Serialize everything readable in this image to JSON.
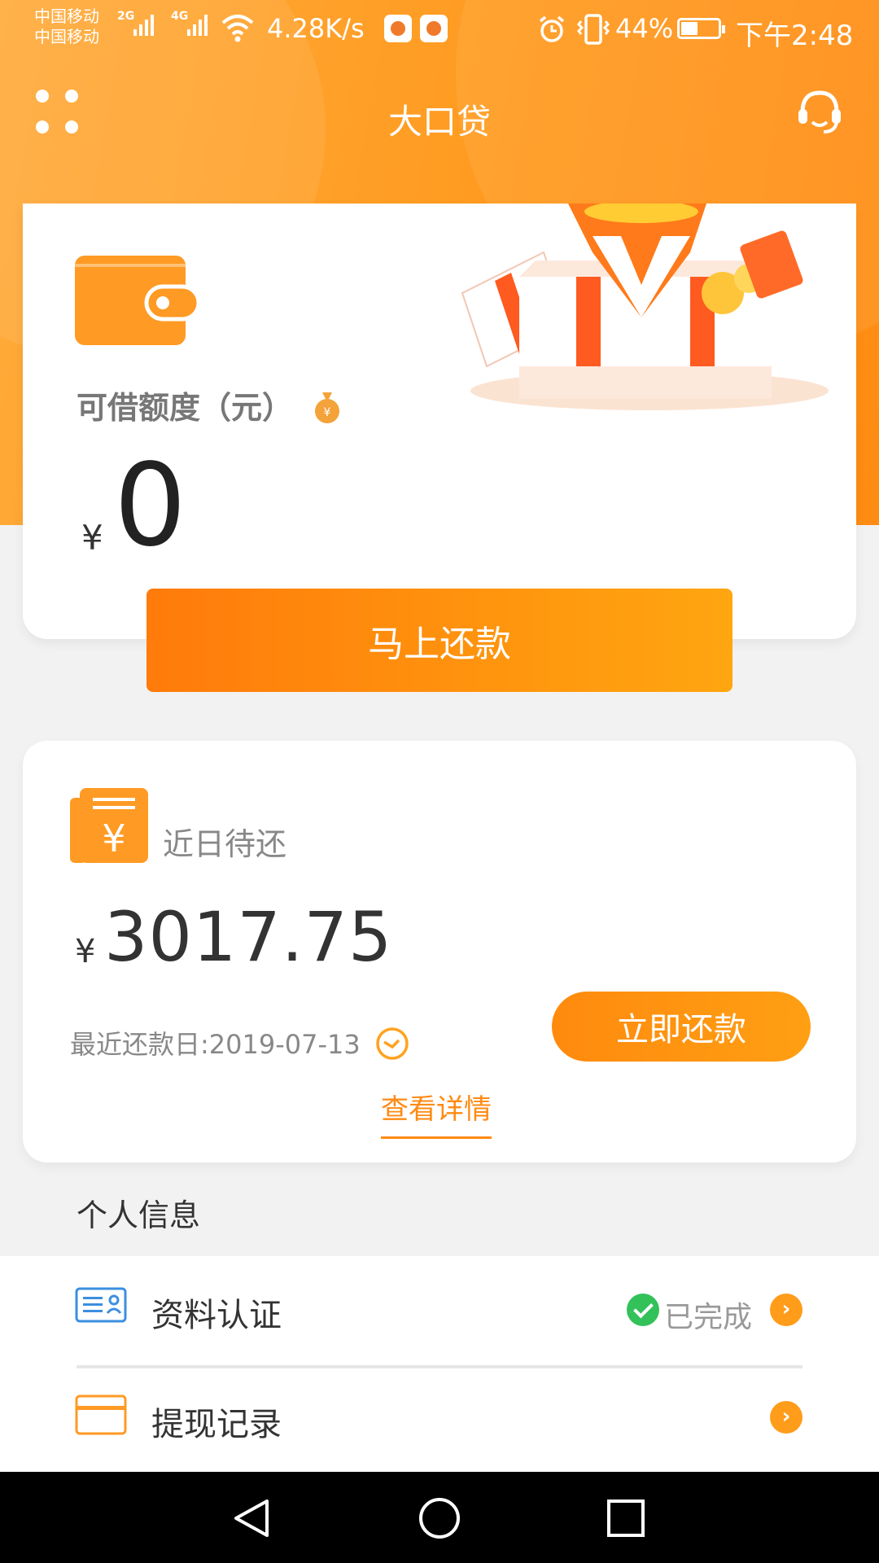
{
  "status_bar": {
    "carrier_1": "中国移动",
    "carrier_2": "中国移动",
    "sim1_net": "2G",
    "sim2_net": "4G",
    "net_speed": "4.28K/s",
    "battery": "44%",
    "time": "下午2:48"
  },
  "header": {
    "title": "大口贷",
    "menu_icon": "grid-dots-icon",
    "support_icon": "headset-icon"
  },
  "credit_card": {
    "label": "可借额度（元）",
    "currency": "¥",
    "amount": "0",
    "icon": "wallet-icon"
  },
  "repay_button": {
    "label": "马上还款"
  },
  "due_card": {
    "label": "近日待还",
    "currency": "¥",
    "amount": "3017.75",
    "due_date": "最近还款日:2019-07-13",
    "pay_button": "立即还款",
    "details_link": "查看详情"
  },
  "personal_info": {
    "title": "个人信息",
    "items": [
      {
        "label": "资料认证",
        "status": "已完成",
        "icon": "id-card-icon"
      },
      {
        "label": "提现记录",
        "status": "",
        "icon": "credit-card-icon"
      }
    ]
  },
  "colors": {
    "primary": "#ff9a1f",
    "button_start": "#ff7b0b",
    "button_end": "#ffa610",
    "success": "#33c15a"
  }
}
